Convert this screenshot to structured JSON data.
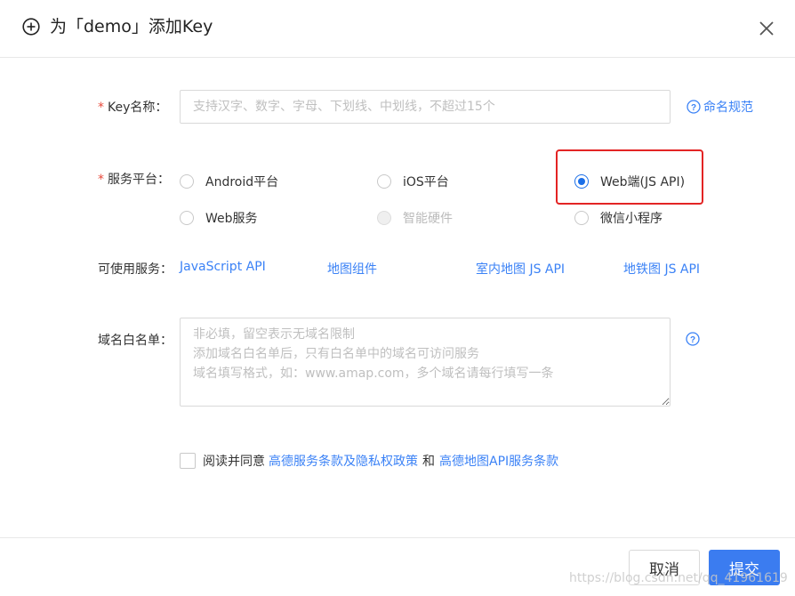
{
  "dialog": {
    "title": "为「demo」添加Key"
  },
  "key_name": {
    "label": "Key名称：",
    "required_mark": "*",
    "placeholder": "支持汉字、数字、字母、下划线、中划线，不超过15个",
    "value": "",
    "help_link": "命名规范"
  },
  "platform": {
    "label": "服务平台：",
    "required_mark": "*",
    "options": [
      {
        "label": "Android平台",
        "checked": false,
        "disabled": false
      },
      {
        "label": "iOS平台",
        "checked": false,
        "disabled": false
      },
      {
        "label": "Web端(JS API)",
        "checked": true,
        "disabled": false
      },
      {
        "label": "Web服务",
        "checked": false,
        "disabled": false
      },
      {
        "label": "智能硬件",
        "checked": false,
        "disabled": true
      },
      {
        "label": "微信小程序",
        "checked": false,
        "disabled": false
      }
    ],
    "highlight_color": "#e32424"
  },
  "services": {
    "label": "可使用服务：",
    "links": [
      "JavaScript API",
      "地图组件",
      "室内地图 JS API",
      "地铁图 JS API"
    ]
  },
  "whitelist": {
    "label": "域名白名单：",
    "placeholder": "非必填，留空表示无域名限制\n添加域名白名单后，只有白名单中的域名可访问服务\n域名填写格式，如：www.amap.com，多个域名请每行填写一条",
    "value": ""
  },
  "agreement": {
    "prefix": "阅读并同意",
    "link1": "高德服务条款及隐私权政策",
    "conjunction": "和",
    "link2": "高德地图API服务条款",
    "checked": false
  },
  "footer": {
    "cancel": "取消",
    "submit": "提交"
  },
  "watermark": "https://blog.csdn.net/qq_41961619",
  "colors": {
    "link": "#3b82f6",
    "primary": "#3b7cf0",
    "required": "#e84a3c",
    "radio_checked": "#1b6fe8"
  }
}
